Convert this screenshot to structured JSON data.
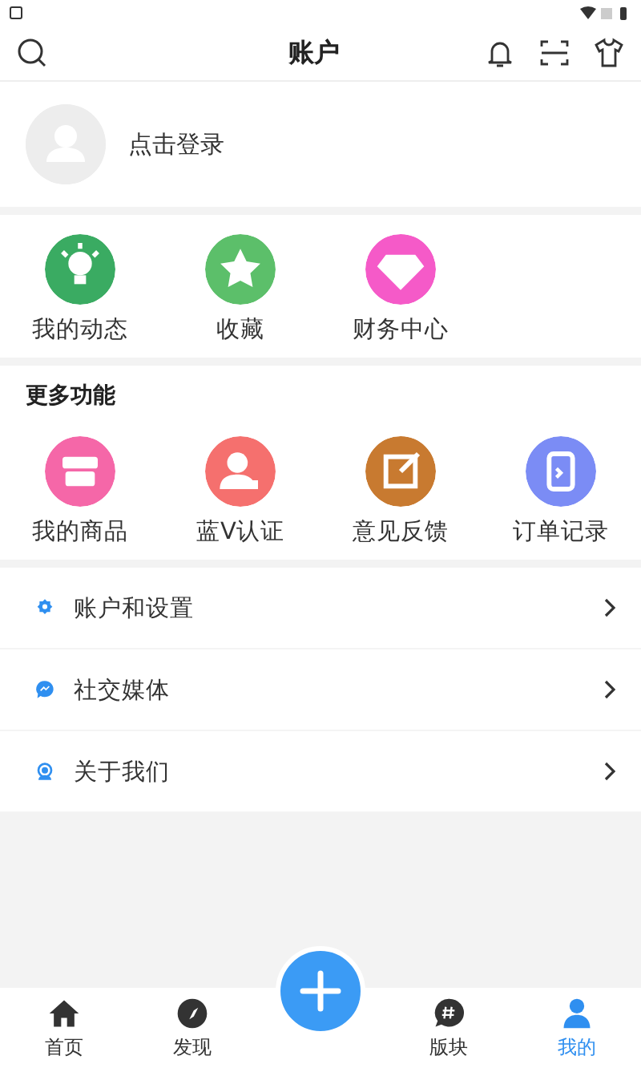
{
  "header": {
    "title": "账户"
  },
  "login": {
    "label": "点击登录"
  },
  "quick": [
    {
      "label": "我的动态",
      "kind": "bulb",
      "color": "#3aab62"
    },
    {
      "label": "收藏",
      "kind": "star",
      "color": "#5cbf6a"
    },
    {
      "label": "财务中心",
      "kind": "gem",
      "color": "#f55ac8"
    }
  ],
  "more": {
    "title": "更多功能",
    "items": [
      {
        "label": "我的商品",
        "kind": "shop",
        "color": "#f567a8"
      },
      {
        "label": "蓝V认证",
        "kind": "badge",
        "color": "#f5706e"
      },
      {
        "label": "意见反馈",
        "kind": "edit",
        "color": "#c87a30"
      },
      {
        "label": "订单记录",
        "kind": "doc",
        "color": "#7b8cf5"
      }
    ]
  },
  "menu": [
    {
      "label": "账户和设置",
      "kind": "gear"
    },
    {
      "label": "社交媒体",
      "kind": "chat"
    },
    {
      "label": "关于我们",
      "kind": "support"
    }
  ],
  "nav": [
    {
      "label": "首页",
      "kind": "home",
      "selected": false
    },
    {
      "label": "发现",
      "kind": "compass",
      "selected": false
    },
    {
      "kind": "add"
    },
    {
      "label": "版块",
      "kind": "hash",
      "selected": false
    },
    {
      "label": "我的",
      "kind": "person",
      "selected": true
    }
  ]
}
